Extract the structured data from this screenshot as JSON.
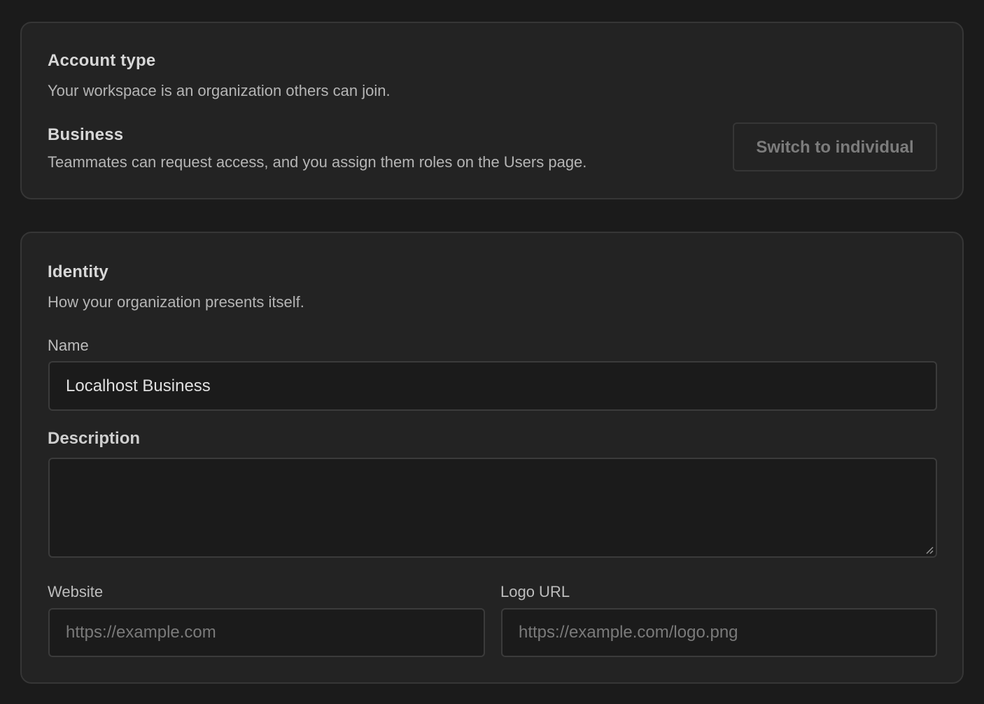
{
  "account_type": {
    "title": "Account type",
    "description": "Your workspace is an organization others can join.",
    "plan_name": "Business",
    "plan_description": "Teammates can request access, and you assign them roles on the Users page.",
    "switch_button_label": "Switch to individual"
  },
  "identity": {
    "title": "Identity",
    "description": "How your organization presents itself.",
    "name_label": "Name",
    "name_value": "Localhost Business",
    "description_label": "Description",
    "description_value": "",
    "website_label": "Website",
    "website_placeholder": "https://example.com",
    "logo_label": "Logo URL",
    "logo_placeholder": "https://example.com/logo.png"
  },
  "icons": {
    "resize": "resize-handle-icon"
  }
}
